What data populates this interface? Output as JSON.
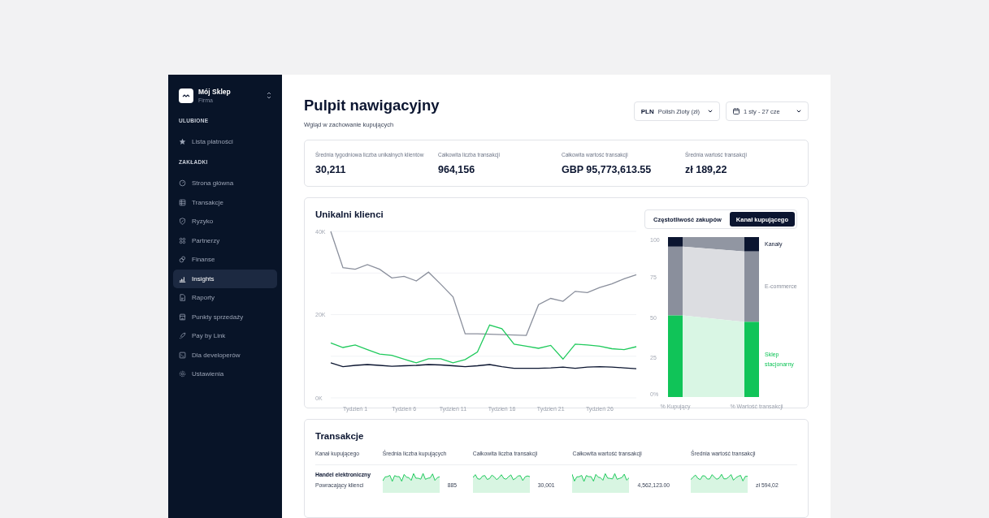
{
  "sidebar": {
    "brand": {
      "name": "Mój Sklep",
      "subtitle": "Firma"
    },
    "sections": [
      {
        "heading": "ULUBIONE",
        "items": [
          {
            "label": "Lista płatności",
            "selected": false
          }
        ]
      },
      {
        "heading": "ZAKŁADKI",
        "items": [
          {
            "label": "Strona główna",
            "selected": false
          },
          {
            "label": "Transakcje",
            "selected": false
          },
          {
            "label": "Ryzyko",
            "selected": false
          },
          {
            "label": "Partnerzy",
            "selected": false
          },
          {
            "label": "Finanse",
            "selected": false
          },
          {
            "label": "Insights",
            "selected": true
          },
          {
            "label": "Raporty",
            "selected": false
          },
          {
            "label": "Punkty sprzedaży",
            "selected": false
          },
          {
            "label": "Pay by Link",
            "selected": false
          },
          {
            "label": "Dla developerów",
            "selected": false
          },
          {
            "label": "Ustawienia",
            "selected": false
          }
        ]
      }
    ]
  },
  "header": {
    "title": "Pulpit nawigacyjny",
    "subtitle": "Wgląd w zachowanie kupujących",
    "currency": {
      "code": "PLN",
      "label": "Polish Zloty (zł)"
    },
    "date_range": {
      "value": "1 sty - 27 cze"
    }
  },
  "stats": [
    {
      "label": "Średnia tygodniowa liczba unikalnych klientów",
      "value": "30,211"
    },
    {
      "label": "Całkowita liczba transakcji",
      "value": "964,156"
    },
    {
      "label": "Całkowita wartość transakcji",
      "value": "GBP 95,773,613.55"
    },
    {
      "label": "Średnia wartość transakcji",
      "value": "zł 189,22"
    }
  ],
  "customers": {
    "title": "Unikalni klienci",
    "toggle": [
      {
        "label": "Częstotliwość zakupów",
        "selected": false
      },
      {
        "label": "Kanał kupującego",
        "selected": true
      }
    ],
    "line_chart": {
      "chart_data": {
        "type": "line",
        "categories": [
          null,
          null,
          "Tydzień 1",
          null,
          null,
          null,
          "Tydzień 6",
          null,
          null,
          null,
          "Tydzień 11",
          null,
          null,
          null,
          "Tydzień 16",
          null,
          null,
          null,
          "Tydzień 21",
          null,
          null,
          null,
          "Tydzień 26",
          null,
          null,
          null
        ],
        "ylim": [
          0,
          40000
        ],
        "yticks": [
          {
            "value": 40000,
            "label": "40K"
          },
          {
            "value": 20000,
            "label": "20K"
          },
          {
            "value": 0,
            "label": "0K"
          }
        ],
        "series": [
          {
            "color": "#8a8f9c",
            "values": [
              40000,
              31300,
              30900,
              32000,
              30900,
              28800,
              29200,
              28100,
              30200,
              27300,
              24300,
              15400,
              15400,
              15300,
              15200,
              15100,
              15000,
              22400,
              23900,
              23200,
              25600,
              25300,
              26500,
              27400,
              28600,
              29600
            ]
          },
          {
            "color": "#1fca5c",
            "values": [
              13200,
              12100,
              12700,
              11600,
              10500,
              10200,
              9300,
              8400,
              9400,
              9400,
              8400,
              9200,
              11000,
              17500,
              16600,
              12900,
              12400,
              11900,
              12600,
              9300,
              12900,
              12700,
              12400,
              11800,
              11600,
              12300
            ]
          },
          {
            "color": "#0b1530",
            "values": [
              8400,
              7500,
              7800,
              8000,
              7800,
              7600,
              7700,
              7800,
              8000,
              7900,
              7700,
              7500,
              7700,
              8000,
              7500,
              7100,
              7100,
              7100,
              7200,
              7400,
              7100,
              7400,
              7500,
              7400,
              7200,
              7000
            ]
          }
        ]
      }
    },
    "channel_chart": {
      "chart_data": {
        "type": "bar",
        "stacked": true,
        "categories": [
          "% Kupujący",
          "% Wartość transakcji"
        ],
        "ylim": [
          0,
          100
        ],
        "yticks": [
          {
            "value": 100,
            "label": "100"
          },
          {
            "value": 75,
            "label": "75"
          },
          {
            "value": 50,
            "label": "50"
          },
          {
            "value": 25,
            "label": "25"
          },
          {
            "value": 0,
            "label": "0%"
          }
        ],
        "series": [
          {
            "name": "Kanały",
            "color": "#0b1530",
            "values": [
              6,
              9
            ]
          },
          {
            "name": "E-commerce",
            "color": "#8a8f9c",
            "values": [
              43,
              44
            ]
          },
          {
            "name": "Sklep stacjonarny",
            "color": "#10c458",
            "values": [
              51,
              47
            ]
          }
        ]
      }
    }
  },
  "transactions": {
    "title": "Transakcje",
    "columns": [
      "Kanał kupującego",
      "Średnia liczba kupujących",
      "Całkowita liczba transakcji",
      "Całkowita wartość transakcji",
      "Średnia wartość transakcji"
    ],
    "rows": [
      {
        "channel": "Handel elektroniczny",
        "segment": "Powracający klienci",
        "values": [
          "885",
          "30,001",
          "4,562,123.00",
          "zł 594,02"
        ]
      }
    ]
  }
}
